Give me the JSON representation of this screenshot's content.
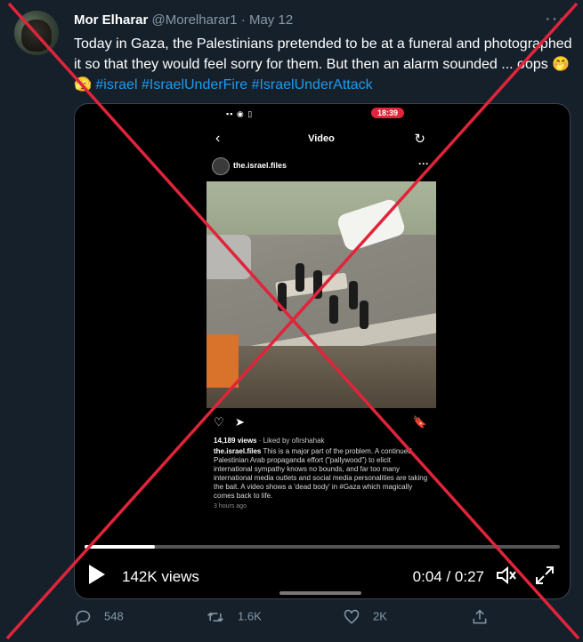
{
  "tweet": {
    "author_name": "Mor Elharar",
    "handle": "@Morelharar1",
    "separator": "·",
    "date": "May 12",
    "more": "···",
    "text": "Today in Gaza, the Palestinians pretended to be at a funeral and photographed it so that they would feel sorry for them.  But then an alarm sounded ... oops 🤭🫣 ",
    "hashtags": [
      "#israel",
      "#IsraelUnderFire",
      "#IsraelUnderAttack"
    ]
  },
  "video": {
    "status_time": "18:39",
    "status_icons": "▪▪ ◉ ▯",
    "nav_back": "‹",
    "nav_title": "Video",
    "nav_refresh": "↻",
    "ig_username": "the.israel.files",
    "ig_more": "···",
    "ig_heart": "♡",
    "ig_share": "➤",
    "ig_save": "🔖",
    "ig_views": "14,189 views",
    "ig_liked_by": " · Liked by ofirshahak",
    "ig_caption_user": "the.israel.files",
    "ig_caption": " This is a major part of the problem. A continued Palestinian Arab propaganda effort (\"pallywood\") to elicit international sympathy knows no bounds, and far too many international media outlets and social media personalities are taking the bait. A video shows a 'dead body' in #Gaza which magically comes back to life.",
    "ig_ago": "3 hours ago",
    "progress": 0.148,
    "views_label": "142K views",
    "time_label": "0:04 / 0:27"
  },
  "actions": {
    "replies": "548",
    "retweets": "1.6K",
    "likes": "2K"
  },
  "colors": {
    "background": "#15202b",
    "accent": "#1d9bf0",
    "muted": "#8899a6",
    "cross": "#e0243a"
  },
  "icons": [
    "reply-icon",
    "retweet-icon",
    "like-icon",
    "share-icon",
    "play-icon",
    "volume-icon",
    "fullscreen-icon"
  ]
}
